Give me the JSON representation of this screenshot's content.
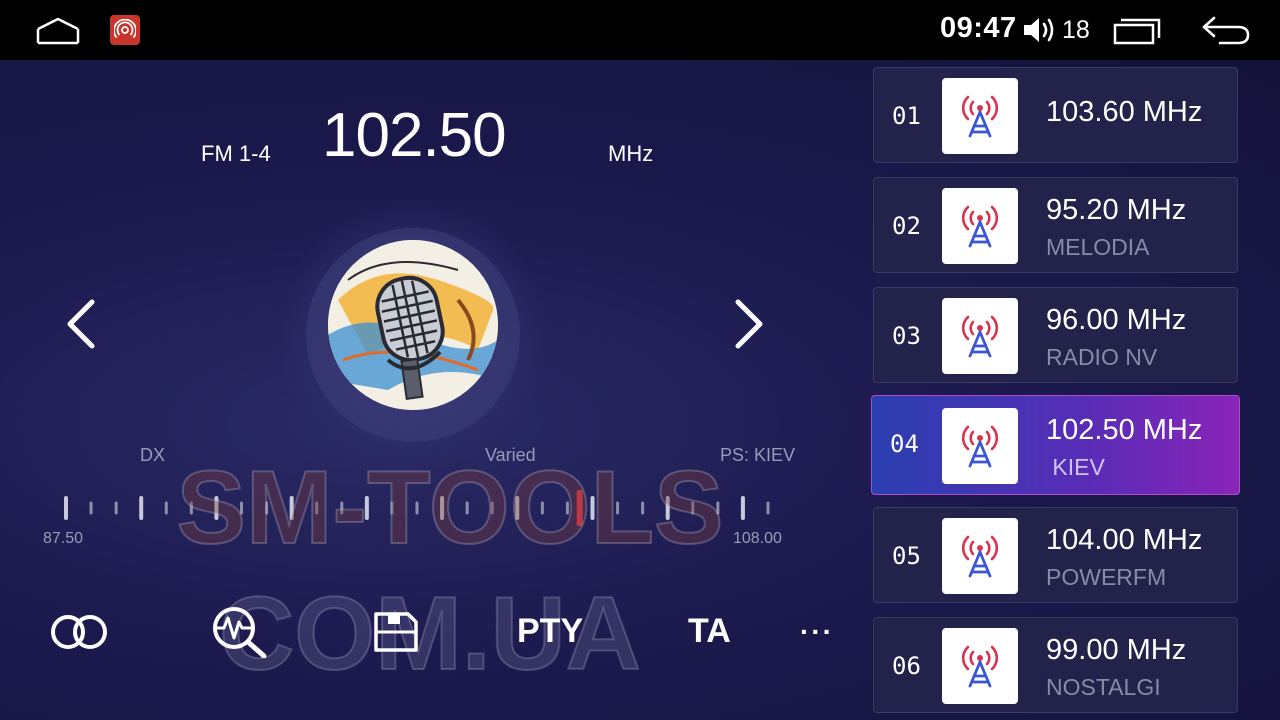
{
  "status_bar": {
    "time": "09:47",
    "volume": "18"
  },
  "radio": {
    "band": "FM 1-4",
    "frequency": "102.50",
    "unit": "MHz",
    "dx_label": "DX",
    "pty_label": "Varied",
    "ps_label": "PS:  KIEV",
    "range_min": "87.50",
    "range_max": "108.00",
    "range_min_value": 87.5,
    "range_max_value": 108.0,
    "tuned_value": 102.5
  },
  "watermark": {
    "line1": "SM-TOOLS",
    "line2": "COM.UA"
  },
  "toolbar": {
    "pty": "PTY",
    "ta": "TA",
    "more": "···"
  },
  "presets": [
    {
      "num": "01",
      "freq": "103.60 MHz",
      "name": ""
    },
    {
      "num": "02",
      "freq": "95.20 MHz",
      "name": "MELODIA"
    },
    {
      "num": "03",
      "freq": "96.00 MHz",
      "name": "RADIO NV"
    },
    {
      "num": "04",
      "freq": "102.50 MHz",
      "name": " KIEV"
    },
    {
      "num": "05",
      "freq": "104.00 MHz",
      "name": "POWERFM"
    },
    {
      "num": "06",
      "freq": "99.00 MHz",
      "name": "NOSTALGI"
    }
  ],
  "active_preset": "04",
  "colors": {
    "status_bar_bg": "#000000",
    "background": "#1c1a4e",
    "accent_marker": "#e5364c",
    "app_icon": "#c7352c",
    "antenna_red": "#d9344f",
    "antenna_blue": "#3a55d6"
  }
}
